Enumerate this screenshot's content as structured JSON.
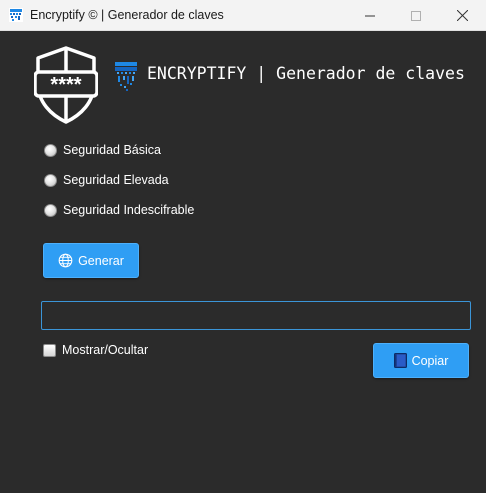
{
  "window": {
    "title": "Encryptify © | Generador de claves",
    "icon": "encryptify-app-icon",
    "controls": [
      "minimize-icon",
      "maximize-icon",
      "close-icon"
    ]
  },
  "header": {
    "title": "ENCRYPTIFY | Generador de claves",
    "shield_icon": "shield-password-icon",
    "logo_icon": "circuit-logo-icon",
    "password_mask": "****"
  },
  "security_levels": [
    {
      "label": "Seguridad Básica",
      "selected": false
    },
    {
      "label": "Seguridad Elevada",
      "selected": false
    },
    {
      "label": "Seguridad Indescifrable",
      "selected": false
    }
  ],
  "generate_button": {
    "label": "Generar",
    "icon": "globe-icon"
  },
  "password_field": {
    "value": "",
    "placeholder": ""
  },
  "show_hide": {
    "label": "Mostrar/Ocultar",
    "checked": false
  },
  "copy_button": {
    "label": "Copiar",
    "icon": "book-icon"
  },
  "colors": {
    "background": "#2b2b2b",
    "accent": "#2f9ef4",
    "field_border": "#3b95d8",
    "text": "#ffffff",
    "titlebar": "#f3f3f3"
  }
}
